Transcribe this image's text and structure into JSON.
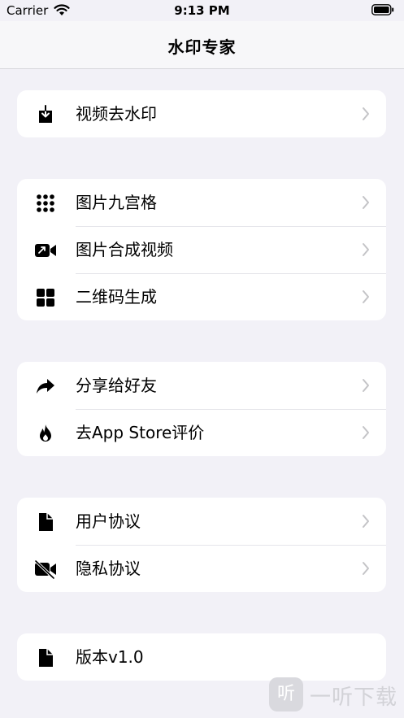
{
  "status_bar": {
    "carrier": "Carrier",
    "time": "9:13 PM"
  },
  "nav": {
    "title": "水印专家"
  },
  "groups": [
    {
      "items": [
        {
          "label": "视频去水印",
          "icon": "download-box-icon"
        }
      ]
    },
    {
      "items": [
        {
          "label": "图片九宫格",
          "icon": "grid-dots-icon"
        },
        {
          "label": "图片合成视频",
          "icon": "video-camera-icon"
        },
        {
          "label": "二维码生成",
          "icon": "four-squares-icon"
        }
      ]
    },
    {
      "items": [
        {
          "label": "分享给好友",
          "icon": "share-arrow-icon"
        },
        {
          "label": "去App Store评价",
          "icon": "flame-icon"
        }
      ]
    },
    {
      "items": [
        {
          "label": "用户协议",
          "icon": "document-icon"
        },
        {
          "label": "隐私协议",
          "icon": "video-slash-icon"
        }
      ]
    },
    {
      "items": [
        {
          "label": "版本v1.0",
          "icon": "document-icon"
        }
      ]
    }
  ],
  "watermark": {
    "badge": "听",
    "text": "一听下载"
  },
  "colors": {
    "background": "#f2f1f7",
    "card": "#ffffff",
    "chevron": "#c4c4c7"
  }
}
